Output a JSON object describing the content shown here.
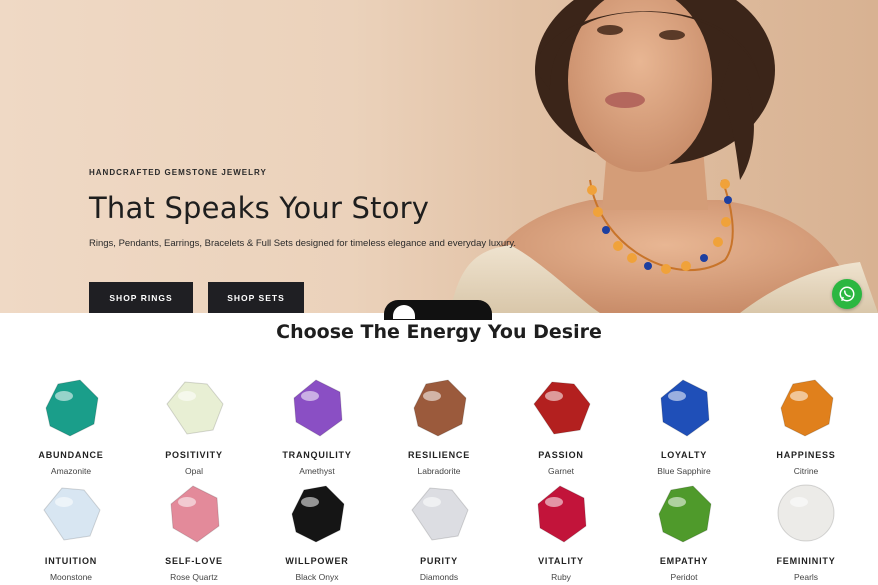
{
  "hero": {
    "eyebrow": "HANDCRAFTED GEMSTONE JEWELRY",
    "title": "That Speaks Your Story",
    "subtitle": "Rings, Pendants, Earrings, Bracelets & Full Sets designed for timeless elegance and everyday luxury.",
    "btn_rings": "SHOP RINGS",
    "btn_sets": "SHOP SETS"
  },
  "section": {
    "title": "Choose The Energy You Desire"
  },
  "gems": [
    {
      "energy": "ABUNDANCE",
      "stone": "Amazonite",
      "icon": "amazonite-gem-icon",
      "color": "#1a9e8a"
    },
    {
      "energy": "POSITIVITY",
      "stone": "Opal",
      "icon": "opal-gem-icon",
      "color": "#e8efd4"
    },
    {
      "energy": "TRANQUILITY",
      "stone": "Amethyst",
      "icon": "amethyst-gem-icon",
      "color": "#8a4fc4"
    },
    {
      "energy": "RESILIENCE",
      "stone": "Labradorite",
      "icon": "labradorite-gem-icon",
      "color": "#9b5a3c"
    },
    {
      "energy": "PASSION",
      "stone": "Garnet",
      "icon": "garnet-gem-icon",
      "color": "#b3201f"
    },
    {
      "energy": "LOYALTY",
      "stone": "Blue Sapphire",
      "icon": "sapphire-gem-icon",
      "color": "#1f4fb8"
    },
    {
      "energy": "HAPPINESS",
      "stone": "Citrine",
      "icon": "citrine-gem-icon",
      "color": "#e0801c"
    },
    {
      "energy": "INTUITION",
      "stone": "Moonstone",
      "icon": "moonstone-gem-icon",
      "color": "#d8e6f2"
    },
    {
      "energy": "SELF-LOVE",
      "stone": "Rose Quartz",
      "icon": "rose-quartz-gem-icon",
      "color": "#e38a9a"
    },
    {
      "energy": "WILLPOWER",
      "stone": "Black Onyx",
      "icon": "onyx-gem-icon",
      "color": "#151515"
    },
    {
      "energy": "PURITY",
      "stone": "Diamonds",
      "icon": "diamond-gem-icon",
      "color": "#dcdde2"
    },
    {
      "energy": "VITALITY",
      "stone": "Ruby",
      "icon": "ruby-gem-icon",
      "color": "#c2143a"
    },
    {
      "energy": "EMPATHY",
      "stone": "Peridot",
      "icon": "peridot-gem-icon",
      "color": "#4f9a2b"
    },
    {
      "energy": "FEMININITY",
      "stone": "Pearls",
      "icon": "pearl-gem-icon",
      "color": "#ecebe8"
    }
  ],
  "colors": {
    "button_bg": "#1f1f23",
    "whatsapp": "#2bb741",
    "hero_bg": "#ebd2bb"
  }
}
